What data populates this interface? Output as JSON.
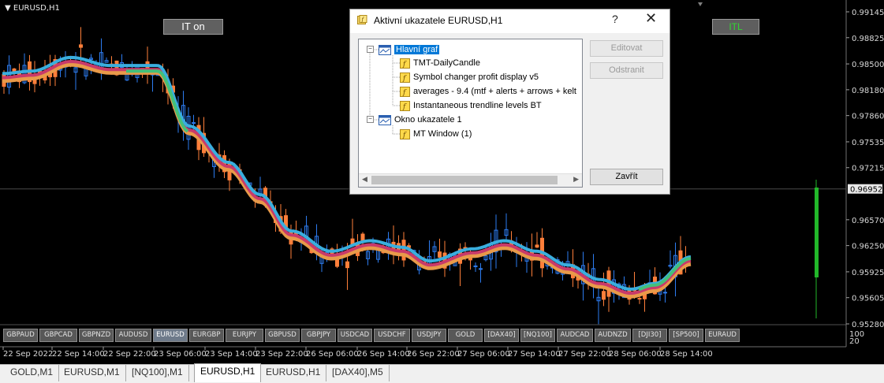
{
  "chart": {
    "symbol_label": "EURUSD,H1",
    "it_button": "IT on",
    "itl_button": "ITL",
    "current_price": "0.96952",
    "price_ticks": [
      "0.99145",
      "0.98825",
      "0.98500",
      "0.98180",
      "0.97860",
      "0.97535",
      "0.97215",
      "0.96570",
      "0.96250",
      "0.95925",
      "0.95605",
      "0.95280"
    ],
    "time_ticks": [
      "22 Sep 2022",
      "22 Sep 14:00",
      "22 Sep 22:00",
      "23 Sep 06:00",
      "23 Sep 14:00",
      "23 Sep 22:00",
      "26 Sep 06:00",
      "26 Sep 14:00",
      "26 Sep 22:00",
      "27 Sep 06:00",
      "27 Sep 14:00",
      "27 Sep 22:00",
      "28 Sep 06:00",
      "28 Sep 14:00"
    ],
    "subwindow_scale": [
      "100",
      "20"
    ],
    "symbol_buttons": [
      "GBPAUD",
      "GBPCAD",
      "GBPNZD",
      "AUDUSD",
      "EURUSD",
      "EURGBP",
      "EURJPY",
      "GBPUSD",
      "GBPJPY",
      "USDCAD",
      "USDCHF",
      "USDJPY",
      "GOLD",
      "[DAX40]",
      "[NQ100]",
      "AUDCAD",
      "AUDNZD",
      "[DJI30]",
      "[SP500]",
      "EURAUD"
    ],
    "active_symbol": "EURUSD",
    "colors": {
      "bull": "#2d7cf0",
      "bear": "#ff7f3a",
      "ma_up": "#3aaede",
      "ma_green": "#44c07a",
      "ma_down": "#c83a6a",
      "ma_orange": "#e89a4a",
      "histogram": "#22b82a"
    }
  },
  "dialog": {
    "title": "Aktivní ukazatele EURUSD,H1",
    "help": "?",
    "close": "✕",
    "tree": {
      "main_chart": "Hlavní graf",
      "main_items": [
        "TMT-DailyCandle",
        "Symbol changer profit display v5",
        "averages - 9.4 (mtf + alerts + arrows + kelt",
        "Instantaneous trendline levels BT"
      ],
      "subwindow": "Okno ukazatele 1",
      "sub_items": [
        "MT Window (1)"
      ]
    },
    "buttons": {
      "edit": "Editovat",
      "delete": "Odstranit",
      "close": "Zavřít"
    }
  },
  "tabs": {
    "items": [
      "GOLD,M1",
      "EURUSD,M1",
      "[NQ100],M1",
      "EURUSD,H1",
      "EURUSD,H1",
      "[DAX40],M5"
    ],
    "active_index": 3
  }
}
